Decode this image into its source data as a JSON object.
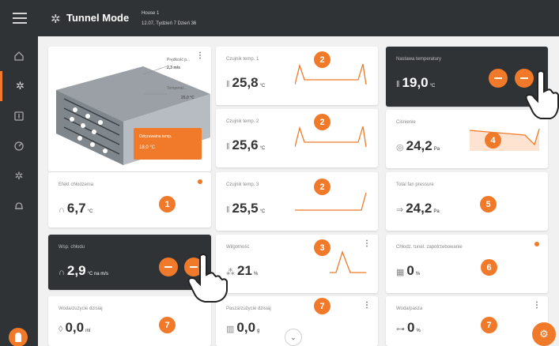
{
  "header": {
    "menu_icon": "hamburger-icon",
    "mode_icon": "fan-icon",
    "title": "Tunnel Mode",
    "house_name": "House 1",
    "date": "12.07, Tydzień 7 Dzień 36"
  },
  "sidebar": {
    "items": [
      {
        "icon": "home-icon"
      },
      {
        "icon": "fan-icon",
        "active": true
      },
      {
        "icon": "thermometer-icon"
      },
      {
        "icon": "gauge-icon"
      },
      {
        "icon": "fan-icon"
      },
      {
        "icon": "bell-icon"
      }
    ]
  },
  "diagram": {
    "top_label": "Prędkość p...",
    "top_value": "2,3 m/s",
    "mid_label": "Temperat...",
    "mid_value": "25,0 °C",
    "out_label": "Odczuwalna temp.",
    "out_value": "18,0 °C"
  },
  "cards": {
    "chill": {
      "label": "Efekt chłodzenia",
      "value": "6,7",
      "unit": "°C",
      "badge": "1"
    },
    "coef": {
      "label": "Wsp. chłodu",
      "value": "2,9",
      "unit": "°C na m/s"
    },
    "water": {
      "label": "Woda/zużycie dzisiaj",
      "value": "0,0",
      "unit": "ml",
      "badge": "7"
    },
    "s1": {
      "label": "Czujnik temp. 1",
      "value": "25,8",
      "unit": "°C",
      "badge": "2"
    },
    "s2": {
      "label": "Czujnik temp. 2",
      "value": "25,6",
      "unit": "°C",
      "badge": "2"
    },
    "s3": {
      "label": "Czujnik temp. 3",
      "value": "25,5",
      "unit": "°C",
      "badge": "2"
    },
    "humidity": {
      "label": "Wilgotność",
      "value": "21",
      "unit": "%",
      "badge": "3"
    },
    "feed": {
      "label": "Pasza/zużycie dzisiaj",
      "value": "0,0",
      "unit": "g",
      "badge": "7"
    },
    "setpoint": {
      "label": "Nastawa temperatury",
      "value": "19,0",
      "unit": "°C"
    },
    "pressure": {
      "label": "Ciśnienie",
      "value": "24,2",
      "unit": "Pa",
      "badge": "4"
    },
    "fan_pressure": {
      "label": "Total fan pressure",
      "value": "24,2",
      "unit": "Pa",
      "badge": "5"
    },
    "cooling_pad": {
      "label": "Chłodz. tunel. zapotrzebowanie",
      "value": "0",
      "unit": "%",
      "badge": "6"
    },
    "water_feed": {
      "label": "Woda/pasza",
      "value": "0",
      "unit": "%",
      "badge": "7"
    }
  },
  "colors": {
    "accent": "#f07a2a",
    "dark": "#2f3336",
    "background": "#f1f1f1"
  }
}
